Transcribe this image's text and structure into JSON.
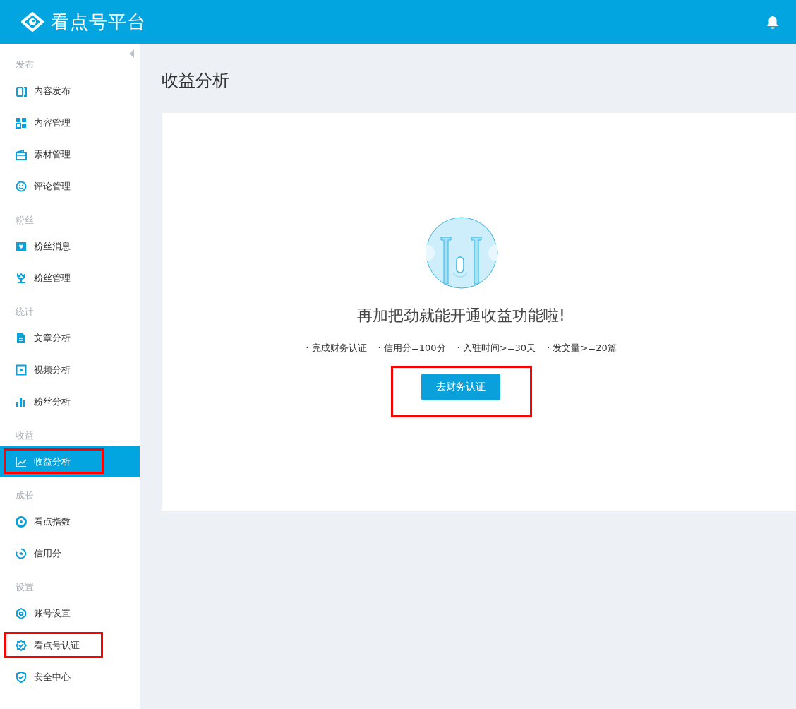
{
  "header": {
    "logo_text": "看点号平台"
  },
  "sidebar": {
    "sections": [
      {
        "label": "发布",
        "items": [
          {
            "label": "内容发布",
            "selected": false,
            "highlighted": false
          },
          {
            "label": "内容管理",
            "selected": false,
            "highlighted": false
          },
          {
            "label": "素材管理",
            "selected": false,
            "highlighted": false
          },
          {
            "label": "评论管理",
            "selected": false,
            "highlighted": false
          }
        ]
      },
      {
        "label": "粉丝",
        "items": [
          {
            "label": "粉丝消息",
            "selected": false,
            "highlighted": false
          },
          {
            "label": "粉丝管理",
            "selected": false,
            "highlighted": false
          }
        ]
      },
      {
        "label": "统计",
        "items": [
          {
            "label": "文章分析",
            "selected": false,
            "highlighted": false
          },
          {
            "label": "视频分析",
            "selected": false,
            "highlighted": false
          },
          {
            "label": "粉丝分析",
            "selected": false,
            "highlighted": false
          }
        ]
      },
      {
        "label": "收益",
        "items": [
          {
            "label": "收益分析",
            "selected": true,
            "highlighted": true
          }
        ]
      },
      {
        "label": "成长",
        "items": [
          {
            "label": "看点指数",
            "selected": false,
            "highlighted": false
          },
          {
            "label": "信用分",
            "selected": false,
            "highlighted": false
          }
        ]
      },
      {
        "label": "设置",
        "items": [
          {
            "label": "账号设置",
            "selected": false,
            "highlighted": false
          },
          {
            "label": "看点号认证",
            "selected": false,
            "highlighted": true
          },
          {
            "label": "安全中心",
            "selected": false,
            "highlighted": false
          }
        ]
      }
    ]
  },
  "page": {
    "title": "收益分析",
    "card": {
      "heading": "再加把劲就能开通收益功能啦!",
      "requirements": [
        "· 完成财务认证",
        "· 信用分=100分",
        "· 入驻时间>=30天",
        "· 发文量>=20篇"
      ],
      "button": {
        "label": "去财务认证",
        "highlighted": true
      }
    }
  }
}
